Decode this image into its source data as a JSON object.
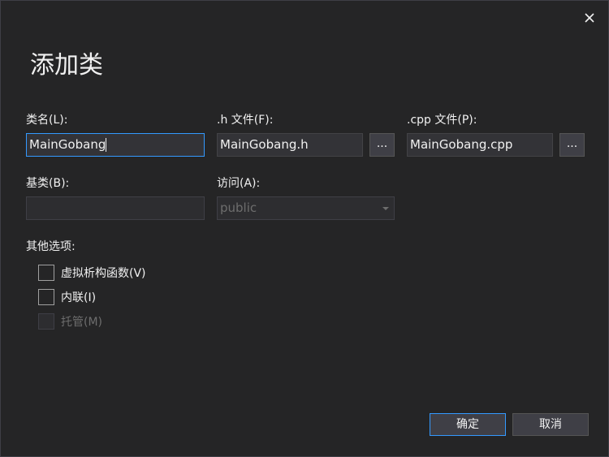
{
  "dialog": {
    "title": "添加类",
    "close_icon": "close-icon"
  },
  "fields": {
    "class_name": {
      "label": "类名(L):",
      "value": "MainGobang"
    },
    "h_file": {
      "label": ".h 文件(F):",
      "value": "MainGobang.h",
      "browse_label": "..."
    },
    "cpp_file": {
      "label": ".cpp 文件(P):",
      "value": "MainGobang.cpp",
      "browse_label": "..."
    },
    "base_class": {
      "label": "基类(B):",
      "value": ""
    },
    "access": {
      "label": "访问(A):",
      "value": "public",
      "options": [
        "public"
      ]
    }
  },
  "other_options": {
    "label": "其他选项:",
    "items": [
      {
        "label": "虚拟析构函数(V)",
        "checked": false,
        "enabled": true
      },
      {
        "label": "内联(I)",
        "checked": false,
        "enabled": true
      },
      {
        "label": "托管(M)",
        "checked": false,
        "enabled": false
      }
    ]
  },
  "buttons": {
    "ok": "确定",
    "cancel": "取消"
  },
  "colors": {
    "background": "#252526",
    "input_bg": "#333337",
    "focus_border": "#3399ff",
    "text": "#f1f1f1",
    "disabled_text": "#6d6d6d"
  }
}
